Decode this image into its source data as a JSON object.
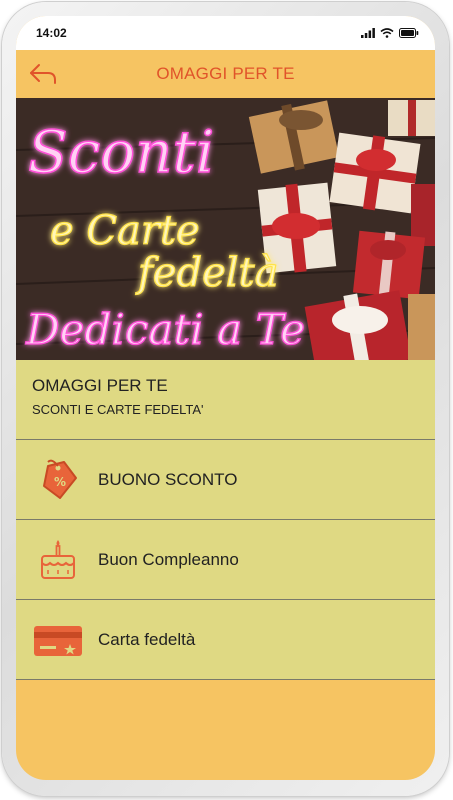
{
  "status_bar": {
    "time": "14:02",
    "icons": [
      "signal-icon",
      "wifi-icon",
      "battery-icon"
    ]
  },
  "app_bar": {
    "title": "OMAGGI PER TE",
    "back_icon": "back-arrow-icon"
  },
  "banner": {
    "line1": "Sconti",
    "line2": "e Carte",
    "line3": "fedeltà",
    "line4": "Dedicati a Te"
  },
  "header": {
    "title": "OMAGGI PER TE",
    "subtitle": "SCONTI E CARTE FEDELTA'"
  },
  "menu": [
    {
      "label": "BUONO SCONTO",
      "icon": "discount-tag-icon"
    },
    {
      "label": "Buon Compleanno",
      "icon": "birthday-cake-icon"
    },
    {
      "label": "Carta fedeltà",
      "icon": "loyalty-card-icon"
    }
  ],
  "colors": {
    "background": "#f6c462",
    "accent": "#e0542a",
    "panel": "#dfd983"
  }
}
